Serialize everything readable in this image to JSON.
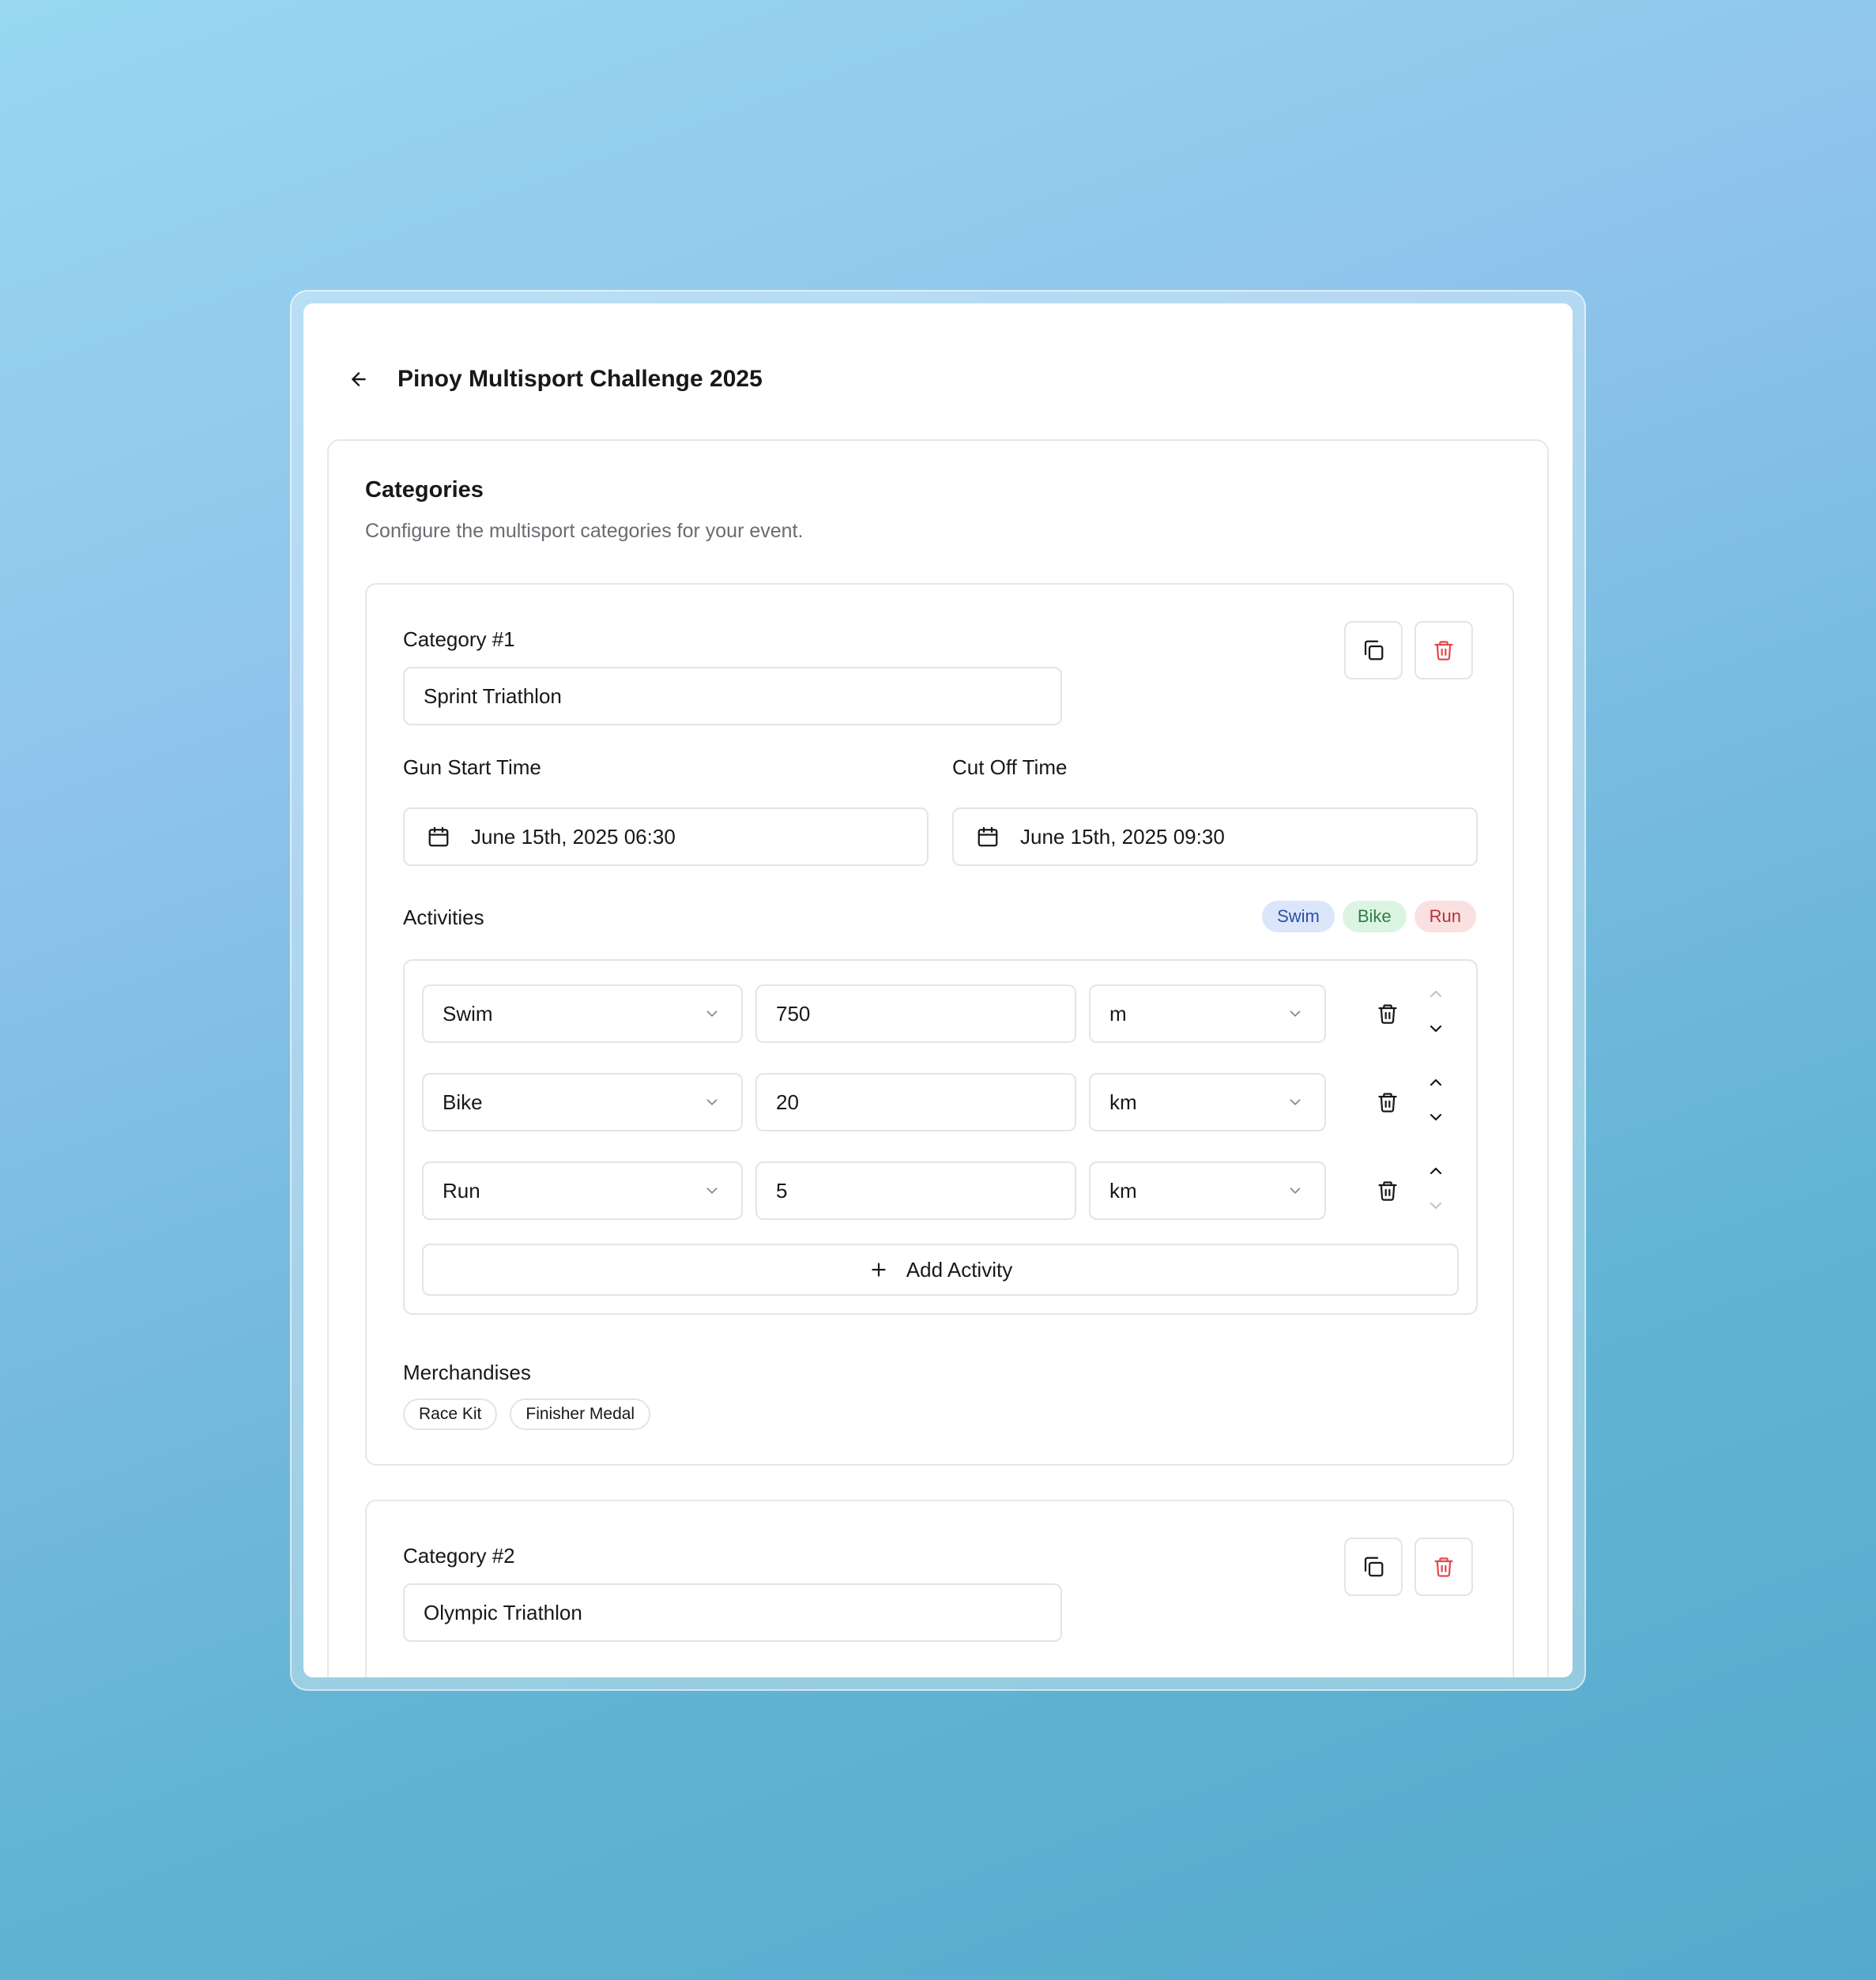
{
  "header": {
    "title": "Pinoy Multisport Challenge 2025"
  },
  "section": {
    "title": "Categories",
    "description": "Configure the multisport categories for your event."
  },
  "categories": [
    {
      "label": "Category #1",
      "name": "Sprint Triathlon",
      "gun_start_label": "Gun Start Time",
      "gun_start_value": "June 15th, 2025 06:30",
      "cut_off_label": "Cut Off Time",
      "cut_off_value": "June 15th, 2025 09:30",
      "activities_label": "Activities",
      "activity_pills": [
        {
          "label": "Swim",
          "bg": "#dbe6fb",
          "fg": "#2b4fa8"
        },
        {
          "label": "Bike",
          "bg": "#dcf5e3",
          "fg": "#2f7d44"
        },
        {
          "label": "Run",
          "bg": "#fbe0e1",
          "fg": "#b3323a"
        }
      ],
      "activities": [
        {
          "type": "Swim",
          "distance": "750",
          "unit": "m"
        },
        {
          "type": "Bike",
          "distance": "20",
          "unit": "km"
        },
        {
          "type": "Run",
          "distance": "5",
          "unit": "km"
        }
      ],
      "add_activity_label": "Add Activity",
      "merch_label": "Merchandises",
      "merchandises": [
        "Race Kit",
        "Finisher Medal"
      ]
    },
    {
      "label": "Category #2",
      "name": "Olympic Triathlon"
    }
  ],
  "icons": {
    "back": "arrow-left-icon",
    "duplicate": "copy-icon",
    "delete": "trash-icon",
    "calendar": "calendar-icon",
    "chevron": "chevron-down-icon",
    "add": "plus-icon"
  },
  "colors": {
    "danger": "#e5484d",
    "border": "#e4e4e7",
    "muted_text": "#6b6b72"
  }
}
